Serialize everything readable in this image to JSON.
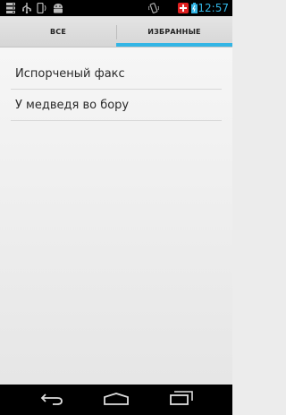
{
  "status_bar": {
    "time": "12:57",
    "icons": [
      "storage-icon",
      "usb-icon",
      "phone-icon",
      "android-icon",
      "vibrate-icon",
      "medical-icon",
      "battery-icon"
    ]
  },
  "tabs": [
    {
      "label": "ВСЕ",
      "selected": false
    },
    {
      "label": "ИЗБРАННЫЕ",
      "selected": true
    }
  ],
  "list": {
    "items": [
      {
        "label": "Испорченый факс"
      },
      {
        "label": "У медведя во бору"
      }
    ]
  },
  "nav_bar": {
    "buttons": [
      "back-icon",
      "home-icon",
      "recent-apps-icon"
    ]
  },
  "colors": {
    "accent": "#33b5e5",
    "status_background": "#000000",
    "tab_background": "#dddddd"
  }
}
